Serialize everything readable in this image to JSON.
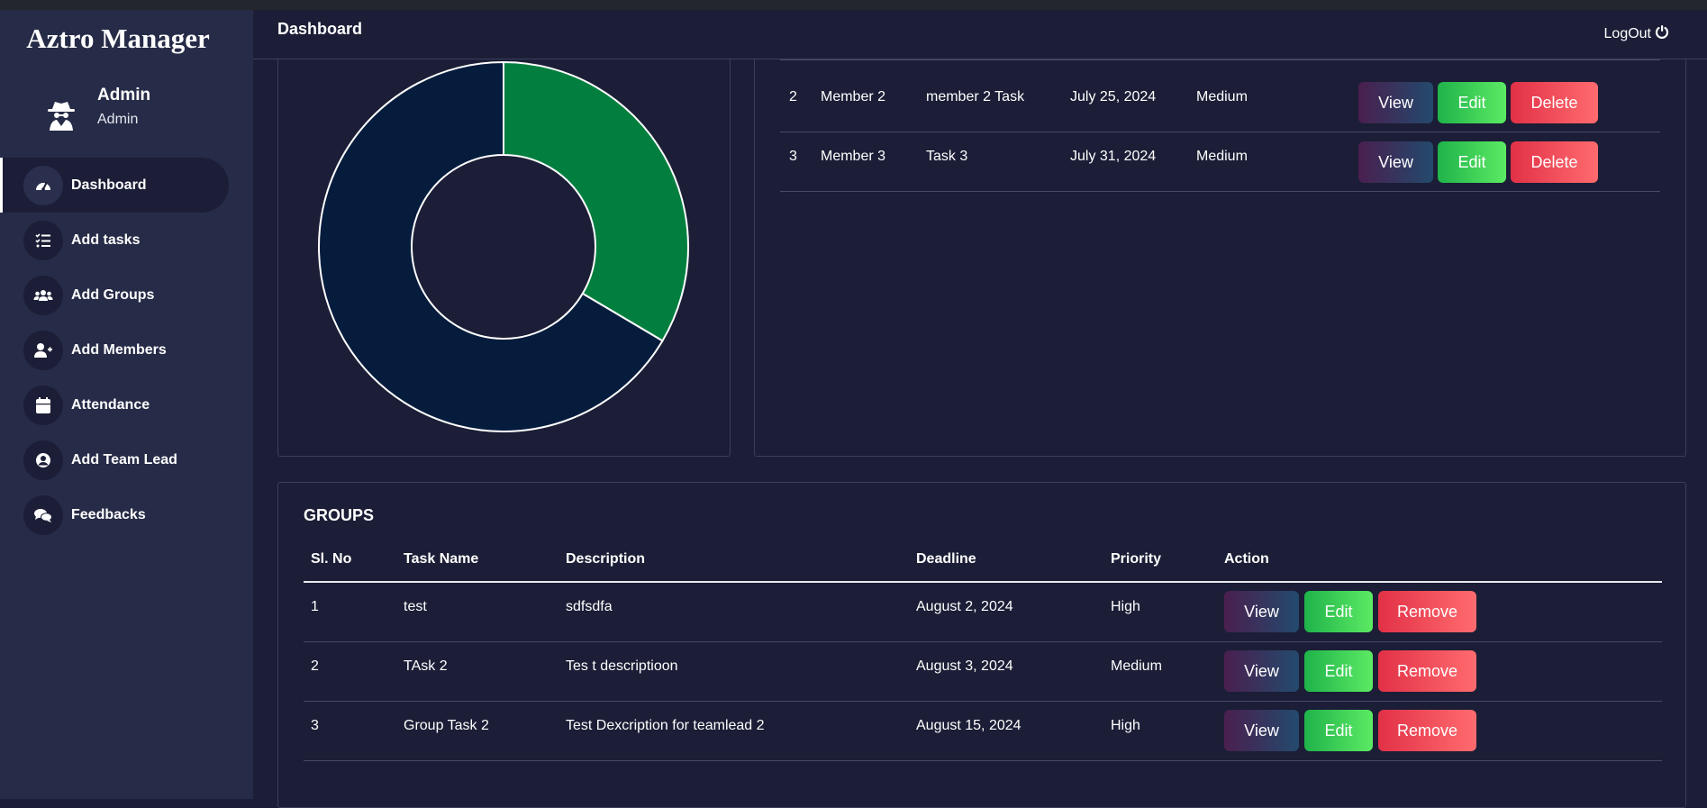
{
  "brand": "Aztro Manager",
  "user": {
    "name": "Admin",
    "role": "Admin"
  },
  "sidebar": {
    "items": [
      {
        "label": "Dashboard",
        "icon": "speedometer-icon",
        "active": true
      },
      {
        "label": "Add tasks",
        "icon": "task-list-icon"
      },
      {
        "label": "Add Groups",
        "icon": "users-icon"
      },
      {
        "label": "Add Members",
        "icon": "user-plus-icon"
      },
      {
        "label": "Attendance",
        "icon": "calendar-icon"
      },
      {
        "label": "Add Team Lead",
        "icon": "user-circle-icon"
      },
      {
        "label": "Feedbacks",
        "icon": "comments-icon"
      }
    ]
  },
  "header": {
    "title": "Dashboard",
    "logout": "LogOut"
  },
  "chart_data": {
    "type": "pie",
    "labels": [],
    "values": [
      33.5,
      66.5
    ],
    "colors": [
      "#027f3f",
      "#061c3d"
    ],
    "donut": true
  },
  "tasks": {
    "rows": [
      {
        "no": "2",
        "member": "Member 2",
        "task": "member 2 Task",
        "deadline": "July 25, 2024",
        "priority": "Medium"
      },
      {
        "no": "3",
        "member": "Member 3",
        "task": "Task 3",
        "deadline": "July 31, 2024",
        "priority": "Medium"
      }
    ],
    "buttons": {
      "view": "View",
      "edit": "Edit",
      "delete": "Delete"
    }
  },
  "groups": {
    "title": "GROUPS",
    "headers": {
      "no": "Sl. No",
      "name": "Task Name",
      "desc": "Description",
      "deadline": "Deadline",
      "priority": "Priority",
      "action": "Action"
    },
    "rows": [
      {
        "no": "1",
        "name": "test",
        "desc": "sdfsdfa",
        "deadline": "August 2, 2024",
        "priority": "High"
      },
      {
        "no": "2",
        "name": "TAsk 2",
        "desc": "Tes t descriptioon",
        "deadline": "August 3, 2024",
        "priority": "Medium"
      },
      {
        "no": "3",
        "name": "Group Task 2",
        "desc": "Test Dexcription for teamlead 2",
        "deadline": "August 15, 2024",
        "priority": "High"
      }
    ],
    "buttons": {
      "view": "View",
      "edit": "Edit",
      "remove": "Remove"
    }
  }
}
